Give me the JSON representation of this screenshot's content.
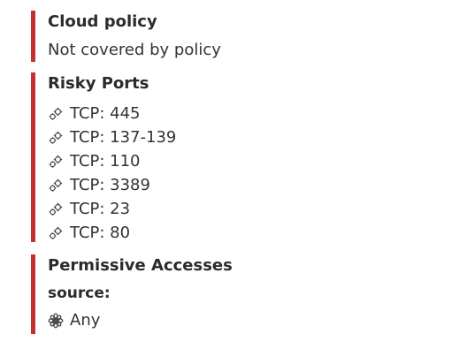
{
  "cloud_policy": {
    "title": "Cloud policy",
    "value": "Not covered by policy"
  },
  "risky_ports": {
    "title": "Risky Ports",
    "icon": "gears-icon",
    "ports": [
      "TCP: 445",
      "TCP: 137-139",
      "TCP: 110",
      "TCP: 3389",
      "TCP: 23",
      "TCP: 80"
    ]
  },
  "permissive_accesses": {
    "title": "Permissive Accesses",
    "source_label": "source:",
    "source_icon": "asterisk-flower-icon",
    "source_value": "Any"
  },
  "colors": {
    "accent_bar": "#c62f2f",
    "text": "#333333"
  }
}
